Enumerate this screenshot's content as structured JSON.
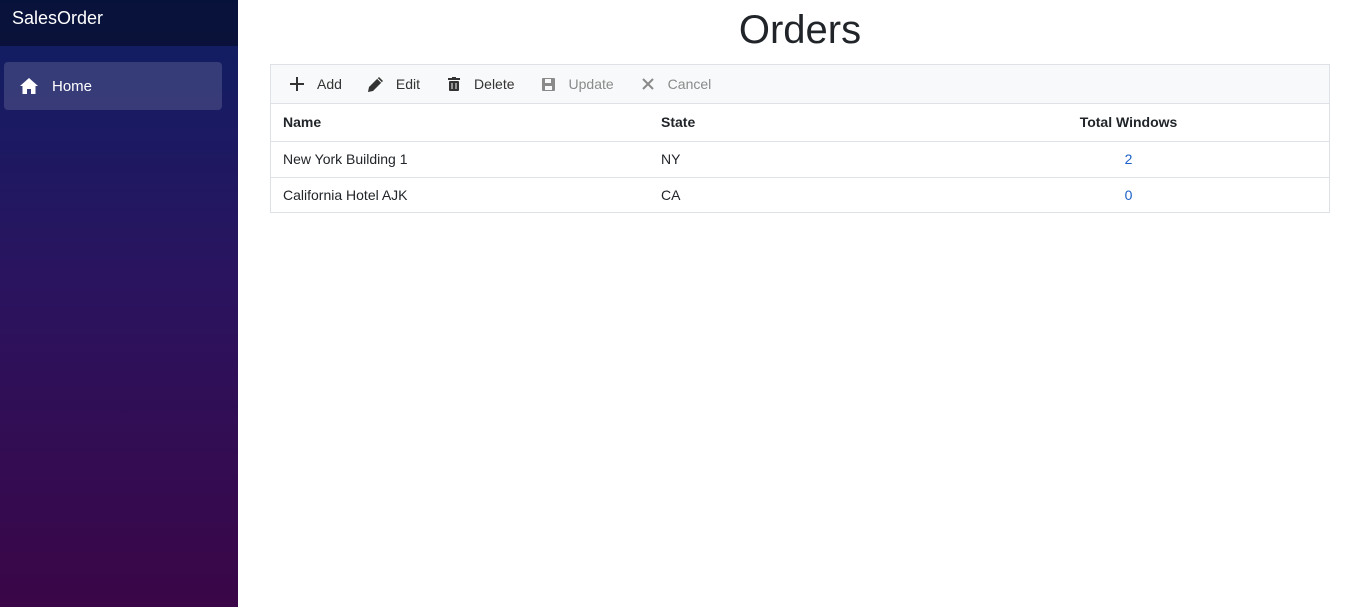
{
  "app": {
    "brand": "SalesOrder"
  },
  "sidebar": {
    "items": [
      {
        "label": "Home",
        "icon": "home-icon"
      }
    ]
  },
  "page": {
    "title": "Orders"
  },
  "toolbar": {
    "add": "Add",
    "edit": "Edit",
    "delete": "Delete",
    "update": "Update",
    "cancel": "Cancel"
  },
  "table": {
    "columns": [
      "Name",
      "State",
      "Total Windows"
    ],
    "rows": [
      {
        "name": "New York Building 1",
        "state": "NY",
        "total": "2"
      },
      {
        "name": "California Hotel AJK",
        "state": "CA",
        "total": "0"
      }
    ]
  },
  "colors": {
    "sidebar_top": "#0d1f63",
    "sidebar_bottom": "#3a0647",
    "link": "#1a5fc6"
  }
}
